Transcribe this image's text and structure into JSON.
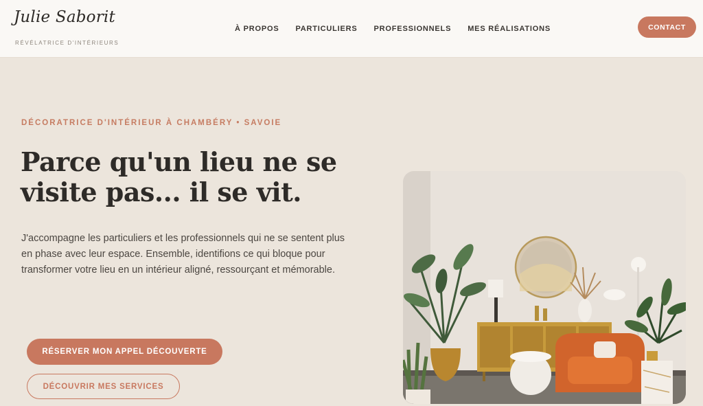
{
  "brand": {
    "logo_text": "Julie Saborit",
    "tagline": "RÉVÉLATRICE D'INTÉRIEURS"
  },
  "nav": {
    "items": [
      {
        "label": "À PROPOS"
      },
      {
        "label": "PARTICULIERS"
      },
      {
        "label": "PROFESSIONNELS"
      },
      {
        "label": "MES RÉALISATIONS"
      }
    ],
    "contact_label": "CONTACT"
  },
  "hero": {
    "eyebrow": "DÉCORATRICE D'INTÉRIEUR À CHAMBÉRY • SAVOIE",
    "headline": "Parce qu'un lieu ne se visite pas... il se vit.",
    "body": "J'accompagne les particuliers et les professionnels qui ne se sentent plus en phase avec leur espace. Ensemble, identifions ce qui bloque pour transformer votre lieu en un intérieur aligné, ressourçant et mémorable.",
    "primary_cta": "RÉSERVER MON APPEL DÉCOUVERTE",
    "secondary_cta": "DÉCOUVRIR MES SERVICES"
  },
  "colors": {
    "accent": "#c8785f",
    "background": "#ece5dc",
    "header_bg": "#faf8f5",
    "text_dark": "#2e2b28"
  }
}
